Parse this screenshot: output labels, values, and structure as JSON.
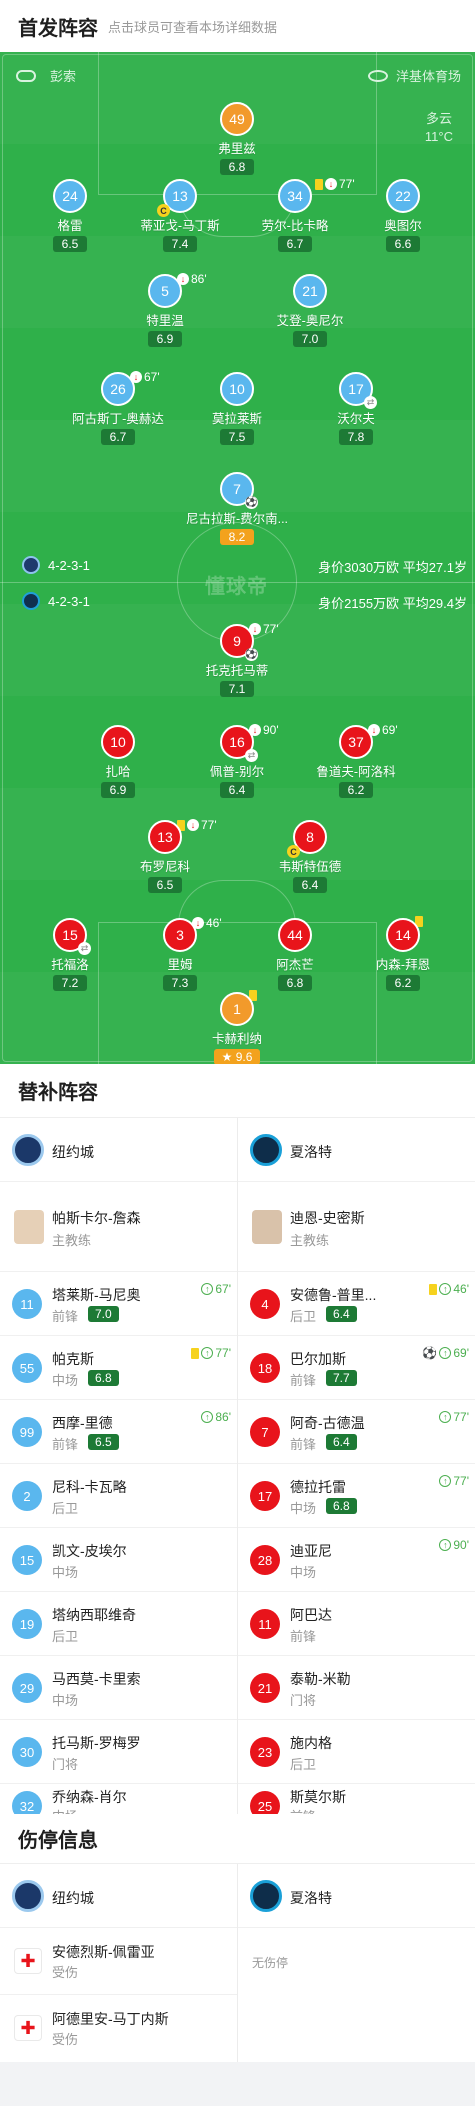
{
  "lineup": {
    "title": "首发阵容",
    "subtitle": "点击球员可查看本场详细数据"
  },
  "pitch": {
    "referee": "彭索",
    "venue": "洋基体育场",
    "weather": "多云",
    "temperature": "11°C",
    "watermark": "懂球帝"
  },
  "home": {
    "formation": "4-2-3-1",
    "value": "身价3030万欧",
    "avg_age": "平均27.1岁"
  },
  "away": {
    "formation": "4-2-3-1",
    "value": "身价2155万欧",
    "avg_age": "平均29.4岁"
  },
  "home_players": [
    {
      "num": "49",
      "name": "弗里兹",
      "rating": "6.8",
      "kind": "orange"
    },
    {
      "num": "24",
      "name": "格雷",
      "rating": "6.5"
    },
    {
      "num": "13",
      "name": "蒂亚戈-马丁斯",
      "rating": "7.4",
      "captain": "C"
    },
    {
      "num": "34",
      "name": "劳尔-比卡略",
      "rating": "6.7",
      "event": "77'"
    },
    {
      "num": "22",
      "name": "奥图尔",
      "rating": "6.6"
    },
    {
      "num": "5",
      "name": "特里温",
      "rating": "6.9",
      "event": "86'"
    },
    {
      "num": "21",
      "name": "艾登-奥尼尔",
      "rating": "7.0"
    },
    {
      "num": "26",
      "name": "阿古斯丁-奥赫达",
      "rating": "6.7",
      "event": "67'"
    },
    {
      "num": "10",
      "name": "莫拉莱斯",
      "rating": "7.5"
    },
    {
      "num": "17",
      "name": "沃尔夫",
      "rating": "7.8"
    },
    {
      "num": "7",
      "name": "尼古拉斯-费尔南...",
      "rating": "8.2"
    }
  ],
  "away_players": [
    {
      "num": "9",
      "name": "托克托马蒂",
      "rating": "7.1",
      "event": "77'"
    },
    {
      "num": "10",
      "name": "扎哈",
      "rating": "6.9"
    },
    {
      "num": "16",
      "name": "佩普-别尔",
      "rating": "6.4",
      "event": "90'"
    },
    {
      "num": "37",
      "name": "鲁道夫-阿洛科",
      "rating": "6.2",
      "event": "69'"
    },
    {
      "num": "13",
      "name": "布罗尼科",
      "rating": "6.5",
      "event": "77'"
    },
    {
      "num": "8",
      "name": "韦斯特伍德",
      "rating": "6.4",
      "captain": "C"
    },
    {
      "num": "15",
      "name": "托福洛",
      "rating": "7.2"
    },
    {
      "num": "3",
      "name": "里姆",
      "rating": "7.3",
      "event": "46'"
    },
    {
      "num": "44",
      "name": "阿杰芒",
      "rating": "6.8"
    },
    {
      "num": "14",
      "name": "内森-拜恩",
      "rating": "6.2"
    },
    {
      "num": "1",
      "name": "卡赫利纳",
      "rating": "9.6",
      "star": "★"
    }
  ],
  "subs": {
    "title": "替补阵容",
    "home_club": "纽约城",
    "away_club": "夏洛特",
    "home_coach": {
      "name": "帕斯卡尔-詹森",
      "role": "主教练"
    },
    "away_coach": {
      "name": "迪恩-史密斯",
      "role": "主教练"
    },
    "home": [
      {
        "num": "11",
        "name": "塔莱斯-马尼奥",
        "pos": "前锋",
        "rating": "7.0",
        "event": "67'"
      },
      {
        "num": "55",
        "name": "帕克斯",
        "pos": "中场",
        "rating": "6.8",
        "event": "77'"
      },
      {
        "num": "99",
        "name": "西摩-里德",
        "pos": "前锋",
        "rating": "6.5",
        "event": "86'"
      },
      {
        "num": "2",
        "name": "尼科-卡瓦略",
        "pos": "后卫"
      },
      {
        "num": "15",
        "name": "凯文-皮埃尔",
        "pos": "中场"
      },
      {
        "num": "19",
        "name": "塔纳西耶维奇",
        "pos": "后卫"
      },
      {
        "num": "29",
        "name": "马西莫-卡里索",
        "pos": "中场"
      },
      {
        "num": "30",
        "name": "托马斯-罗梅罗",
        "pos": "门将"
      },
      {
        "num": "32",
        "name": "乔纳森-肖尔",
        "pos": "中场"
      }
    ],
    "away": [
      {
        "num": "4",
        "name": "安德鲁-普里...",
        "pos": "后卫",
        "rating": "6.4",
        "event": "46'"
      },
      {
        "num": "18",
        "name": "巴尔加斯",
        "pos": "前锋",
        "rating": "7.7",
        "event": "69'"
      },
      {
        "num": "7",
        "name": "阿奇-古德温",
        "pos": "前锋",
        "rating": "6.4",
        "event": "77'"
      },
      {
        "num": "17",
        "name": "德拉托雷",
        "pos": "中场",
        "rating": "6.8",
        "event": "77'"
      },
      {
        "num": "28",
        "name": "迪亚尼",
        "pos": "中场",
        "event": "90'"
      },
      {
        "num": "11",
        "name": "阿巴达",
        "pos": "前锋"
      },
      {
        "num": "21",
        "name": "泰勒-米勒",
        "pos": "门将"
      },
      {
        "num": "23",
        "name": "施内格",
        "pos": "后卫"
      },
      {
        "num": "25",
        "name": "斯莫尔斯",
        "pos": "前锋"
      }
    ]
  },
  "injury": {
    "title": "伤停信息",
    "home_club": "纽约城",
    "away_club": "夏洛特",
    "home": [
      {
        "name": "安德烈斯-佩雷亚",
        "status": "受伤"
      },
      {
        "name": "阿德里安-马丁内斯",
        "status": "受伤"
      }
    ],
    "away_none": "无伤停"
  },
  "colors": {
    "pitch": "#2fb04a",
    "home": "#5ab7ee",
    "away": "#e8141b",
    "rating": "#1d7a35",
    "gold": "#f3a21d"
  }
}
